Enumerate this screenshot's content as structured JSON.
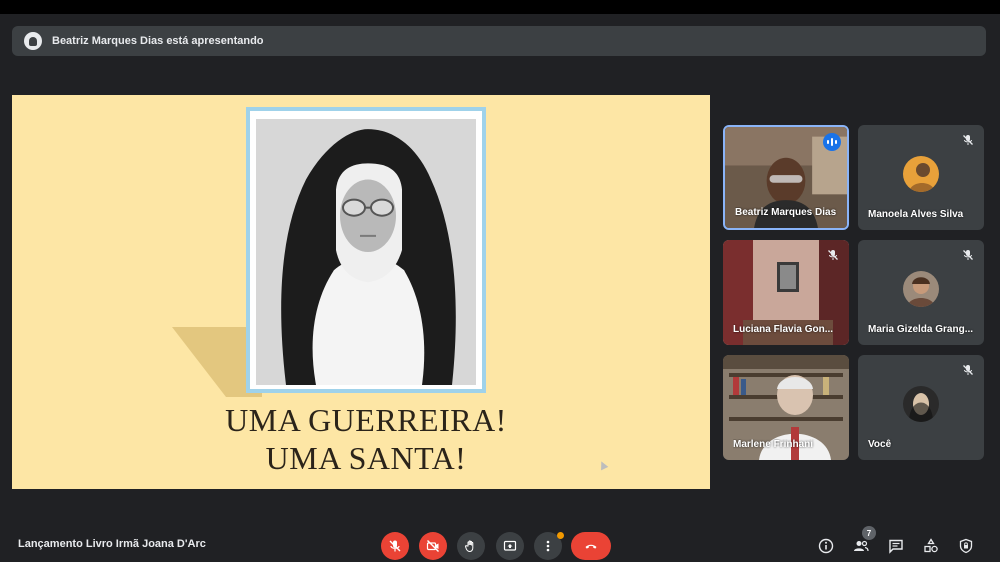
{
  "banner": {
    "presenting_text": "Beatriz Marques Dias está apresentando"
  },
  "slide": {
    "title_line1": "UMA GUERREIRA!",
    "title_line2": "UMA SANTA!"
  },
  "participants": [
    {
      "name": "Beatriz Marques Dias",
      "speaking": true
    },
    {
      "name": "Manoela Alves Silva",
      "muted": true
    },
    {
      "name": "Luciana Flavia Gon...",
      "muted": true
    },
    {
      "name": "Maria Gizelda Grang...",
      "muted": true
    },
    {
      "name": "Marlene Frinhani",
      "muted": false
    },
    {
      "name": "Você",
      "muted": true
    }
  ],
  "meeting": {
    "title": "Lançamento Livro Irmã Joana D'Arc",
    "participant_count": "7"
  },
  "colors": {
    "background": "#202124",
    "slide_background": "#fde6a5",
    "tile_background": "#3c4043",
    "danger_red": "#ea4335",
    "active_blue": "#8ab4f8",
    "speaking_blue": "#1a73e8"
  },
  "icons": {
    "controls": [
      "mic-off-icon",
      "camera-off-icon",
      "raise-hand-icon",
      "present-screen-icon",
      "more-options-icon",
      "end-call-icon"
    ],
    "right": [
      "info-icon",
      "people-icon",
      "chat-icon",
      "activities-icon",
      "host-controls-icon"
    ]
  }
}
